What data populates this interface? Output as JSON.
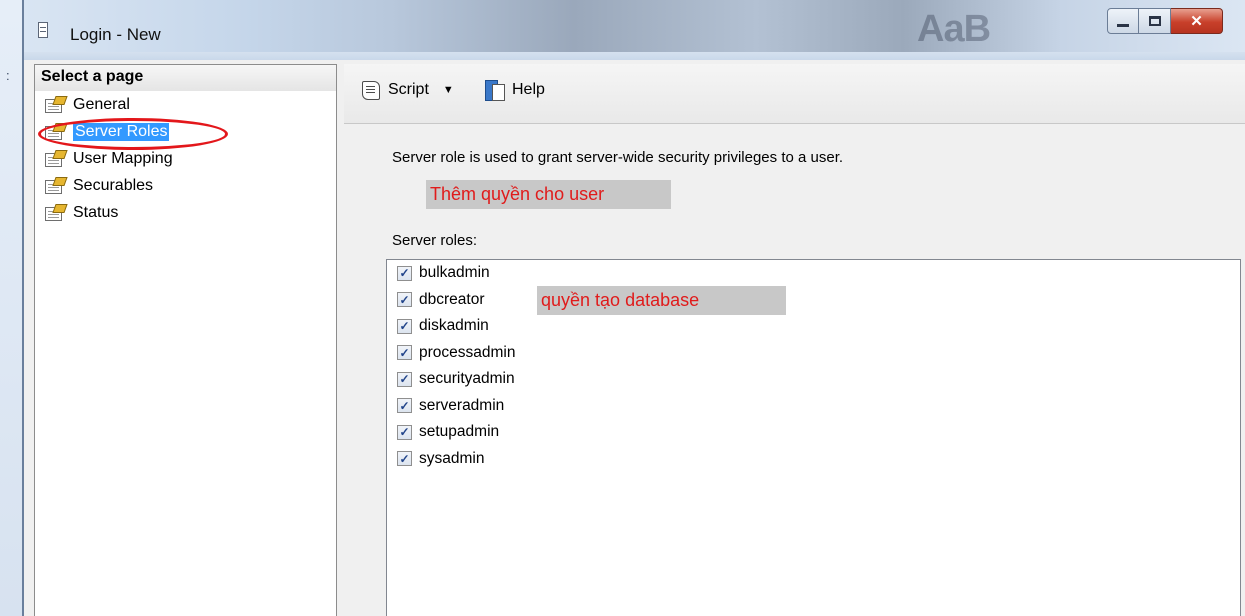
{
  "window": {
    "title": "Login - New",
    "background_text": "AaB"
  },
  "left_pane": {
    "header": "Select a page",
    "items": [
      {
        "label": "General"
      },
      {
        "label": "Server Roles",
        "selected": true
      },
      {
        "label": "User Mapping"
      },
      {
        "label": "Securables"
      },
      {
        "label": "Status"
      }
    ]
  },
  "toolbar": {
    "script_label": "Script",
    "help_label": "Help"
  },
  "content": {
    "description": "Server role is used to grant server-wide security privileges to a user.",
    "note_add_permission": "Thêm quyền cho user",
    "roles_label": "Server roles:",
    "note_create_db": "quyền tạo database",
    "roles": [
      {
        "name": "bulkadmin",
        "checked": true
      },
      {
        "name": "dbcreator",
        "checked": true
      },
      {
        "name": "diskadmin",
        "checked": true
      },
      {
        "name": "processadmin",
        "checked": true
      },
      {
        "name": "securityadmin",
        "checked": true
      },
      {
        "name": "serveradmin",
        "checked": true
      },
      {
        "name": "setupadmin",
        "checked": true
      },
      {
        "name": "sysadmin",
        "checked": true
      }
    ]
  },
  "colors": {
    "selection": "#3399ff",
    "annotation_red": "#e01b1b",
    "annotation_bg": "#c8c8c8"
  }
}
